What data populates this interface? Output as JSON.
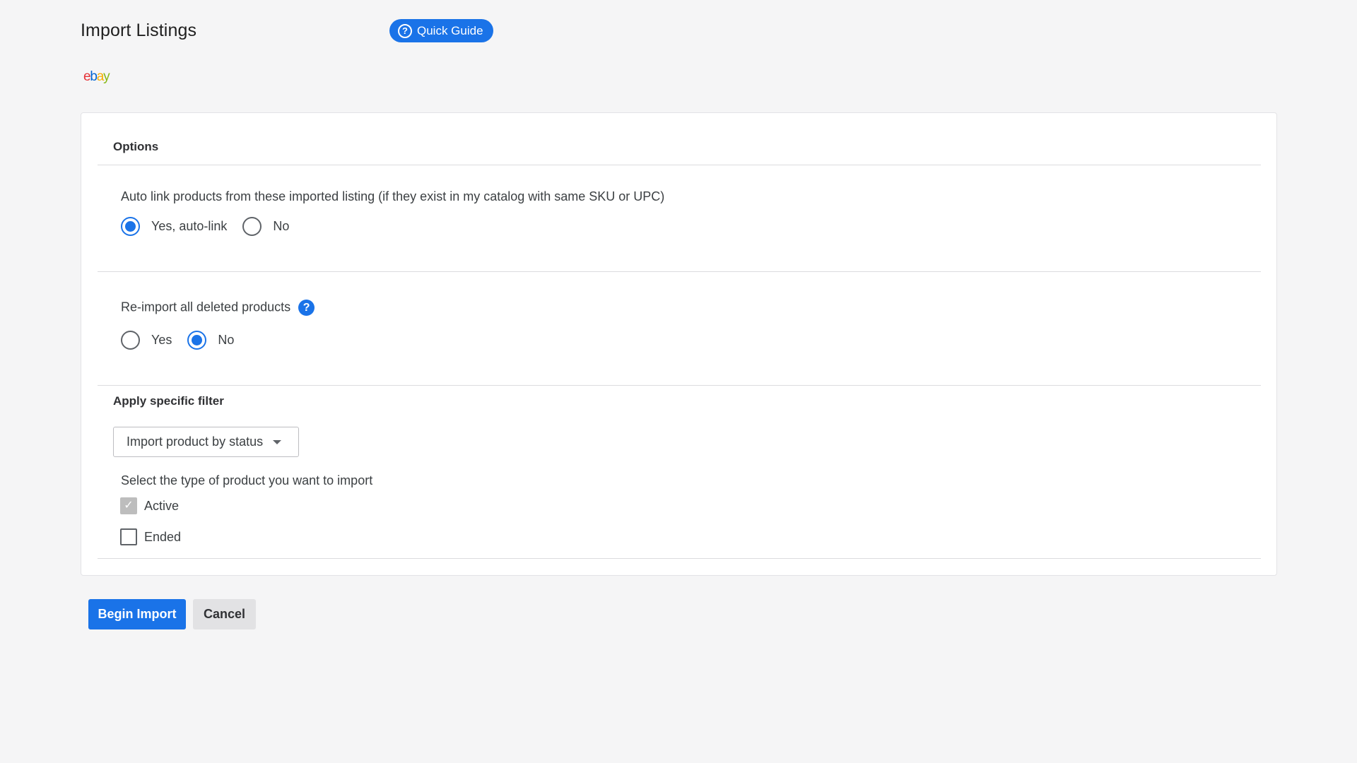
{
  "page": {
    "title": "Import Listings",
    "quick_guide_label": "Quick Guide",
    "quick_guide_icon": "question-circle-icon"
  },
  "logo": {
    "letters": [
      "e",
      "b",
      "a",
      "y"
    ],
    "colors": [
      "#e53238",
      "#0064d2",
      "#f5af02",
      "#86b817"
    ]
  },
  "options": {
    "heading": "Options",
    "auto_link": {
      "question": "Auto link products from these imported listing (if they exist in my catalog with same SKU or UPC)",
      "options": [
        {
          "label": "Yes, auto-link",
          "checked": true
        },
        {
          "label": "No",
          "checked": false
        }
      ]
    },
    "reimport": {
      "question": "Re-import all deleted products",
      "help_icon": "question-mark-icon",
      "options": [
        {
          "label": "Yes",
          "checked": false
        },
        {
          "label": "No",
          "checked": true
        }
      ]
    }
  },
  "filter": {
    "heading": "Apply specific filter",
    "select_value": "Import product by status",
    "type_prompt": "Select the type of product you want to import",
    "types": [
      {
        "label": "Active",
        "checked": true,
        "disabled": true
      },
      {
        "label": "Ended",
        "checked": false,
        "disabled": false
      }
    ]
  },
  "actions": {
    "begin_label": "Begin Import",
    "cancel_label": "Cancel"
  },
  "colors": {
    "accent": "#1a73e8",
    "background": "#f5f5f6"
  }
}
